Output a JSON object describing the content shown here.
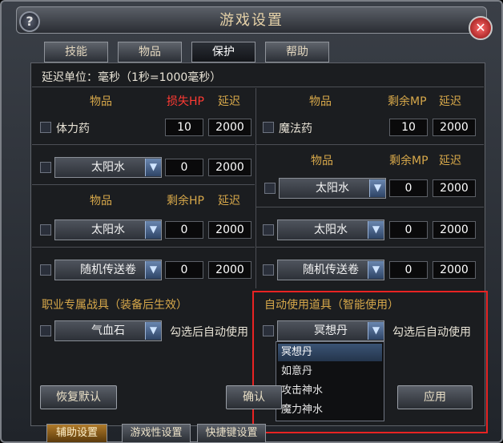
{
  "window": {
    "title": "游戏设置"
  },
  "tabs": [
    "技能",
    "物品",
    "保护",
    "帮助"
  ],
  "latency_unit": "延迟单位：毫秒（1秒=1000毫秒）",
  "left_block": {
    "header": {
      "item": "物品",
      "loss_hp": "损失HP",
      "delay": "延迟"
    },
    "row1": {
      "item": "体力药",
      "value": "10",
      "delay": "2000"
    },
    "row2": {
      "item": "太阳水",
      "value": "0",
      "delay": "2000"
    },
    "subheader": {
      "item": "物品",
      "remaining_hp": "剩余HP",
      "delay": "延迟"
    },
    "row3": {
      "item": "太阳水",
      "value": "0",
      "delay": "2000"
    },
    "row4": {
      "item": "随机传送卷",
      "value": "0",
      "delay": "2000"
    }
  },
  "right_block": {
    "header": {
      "item": "物品",
      "remaining_mp": "剩余MP",
      "delay": "延迟"
    },
    "row1": {
      "item": "魔法药",
      "value": "10",
      "delay": "2000"
    },
    "subheader": {
      "item": "物品",
      "remaining_mp": "剩余MP",
      "delay": "延迟"
    },
    "row2": {
      "item": "太阳水",
      "value": "0",
      "delay": "2000"
    },
    "row3": {
      "item": "太阳水",
      "value": "0",
      "delay": "2000"
    },
    "row4": {
      "item": "随机传送卷",
      "value": "0",
      "delay": "2000"
    }
  },
  "class_gear": {
    "title": "职业专属战具（装备后生效）",
    "dropdown": "气血石",
    "auto_use": "勾选后自动使用"
  },
  "auto_items": {
    "title": "自动使用道具（智能使用）",
    "dropdown": "冥想丹",
    "auto_use": "勾选后自动使用",
    "options": [
      "冥想丹",
      "如意丹",
      "攻击神水",
      "魔力神水"
    ]
  },
  "buttons": {
    "restore_default": "恢复默认",
    "confirm": "确认",
    "apply": "应用"
  },
  "bottom_tabs": [
    "辅助设置",
    "游戏性设置",
    "快捷键设置"
  ],
  "colors": {
    "gold": "#d7a84a",
    "red": "#ff3a33",
    "highlight": "#e82323"
  }
}
